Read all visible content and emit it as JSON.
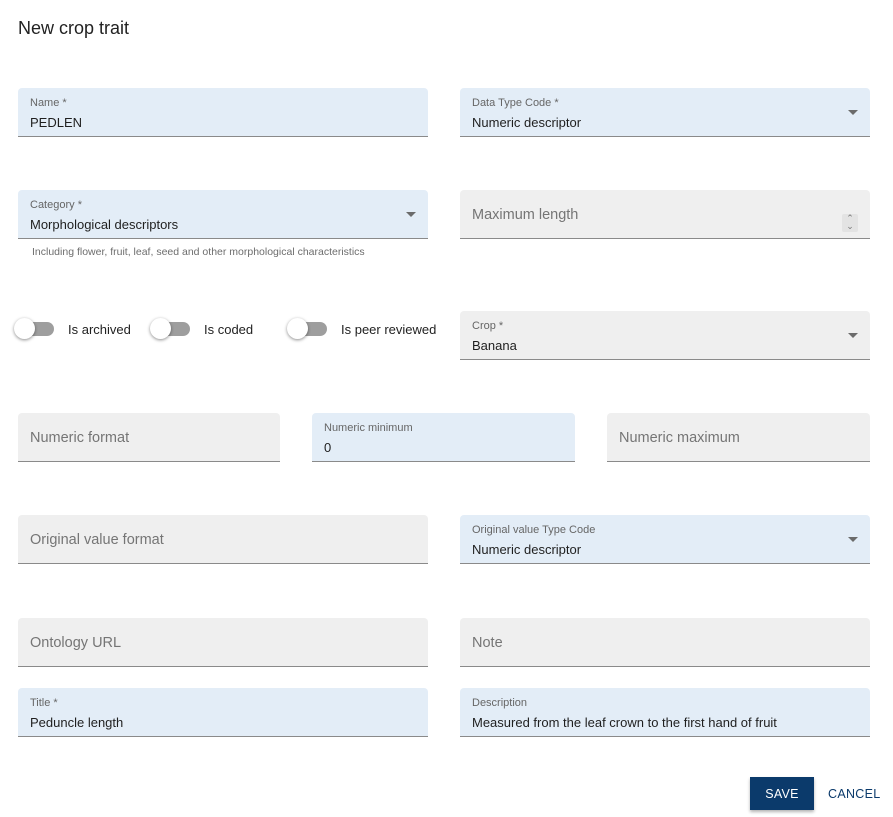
{
  "dialog": {
    "title": "New crop trait"
  },
  "fields": {
    "name": {
      "label": "Name *",
      "value": "PEDLEN"
    },
    "data_type_code": {
      "label": "Data Type Code *",
      "value": "Numeric descriptor"
    },
    "category": {
      "label": "Category *",
      "value": "Morphological descriptors",
      "helper": "Including flower, fruit, leaf, seed and other morphological characteristics"
    },
    "maximum_length": {
      "placeholder": "Maximum length"
    },
    "crop": {
      "label": "Crop *",
      "value": "Banana"
    },
    "numeric_format": {
      "placeholder": "Numeric format"
    },
    "numeric_minimum": {
      "label": "Numeric minimum",
      "value": "0"
    },
    "numeric_maximum": {
      "placeholder": "Numeric maximum"
    },
    "original_value_format": {
      "placeholder": "Original value format"
    },
    "original_value_type_code": {
      "label": "Original value Type Code",
      "value": "Numeric descriptor"
    },
    "ontology_url": {
      "placeholder": "Ontology URL"
    },
    "note": {
      "placeholder": "Note"
    },
    "title": {
      "label": "Title *",
      "value": "Peduncle length"
    },
    "description": {
      "label": "Description",
      "value": "Measured from the leaf crown to the first hand of fruit"
    }
  },
  "toggles": [
    {
      "label": "Is archived",
      "checked": false
    },
    {
      "label": "Is coded",
      "checked": false
    },
    {
      "label": "Is peer reviewed",
      "checked": false
    }
  ],
  "actions": {
    "save": "SAVE",
    "cancel": "CANCEL"
  },
  "colors": {
    "primary": "#0b3a6b",
    "filled_bg": "#e3edf7",
    "empty_bg": "#efefef"
  }
}
